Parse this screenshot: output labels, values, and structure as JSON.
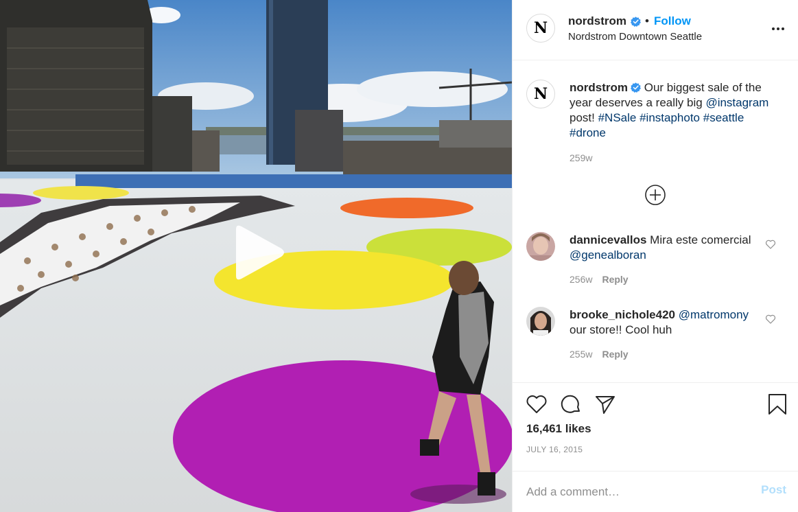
{
  "media": {
    "type": "video"
  },
  "header": {
    "logo_letter": "N",
    "username": "nordstrom",
    "separator": "•",
    "follow_label": "Follow",
    "location": "Nordstrom Downtown Seattle"
  },
  "caption": {
    "logo_letter": "N",
    "username": "nordstrom",
    "text_1": " Our biggest sale of the year deserves a really big ",
    "mention": "@instagram",
    "text_2": " post! ",
    "tag_1": "#NSale",
    "tag_2": "#instaphoto",
    "tag_3": "#seattle",
    "tag_4": "#drone",
    "time": "259w"
  },
  "comments": [
    {
      "username": "dannicevallos",
      "text": " Mira este comercial ",
      "mention": "@genealboran",
      "text_after": "",
      "time": "256w",
      "reply_label": "Reply"
    },
    {
      "username": "brooke_nichole420",
      "text": " ",
      "mention": "@matromony",
      "text_after": " our store!! Cool huh",
      "time": "255w",
      "reply_label": "Reply"
    }
  ],
  "footer": {
    "likes": "16,461 likes",
    "date": "JULY 16, 2015"
  },
  "add_comment": {
    "placeholder": "Add a comment…",
    "post_label": "Post"
  },
  "colors": {
    "accent": "#0095f6",
    "link": "#00376b",
    "verified": "#3897f0",
    "post_disabled": "#b2dffc",
    "muted": "#8e8e8e"
  },
  "icons": {
    "verified": "verified-badge-icon",
    "more": "more-options-icon",
    "load_more": "plus-circle-icon",
    "like": "heart-icon",
    "comment": "comment-bubble-icon",
    "share": "paper-plane-icon",
    "save": "bookmark-icon",
    "play": "play-icon"
  }
}
